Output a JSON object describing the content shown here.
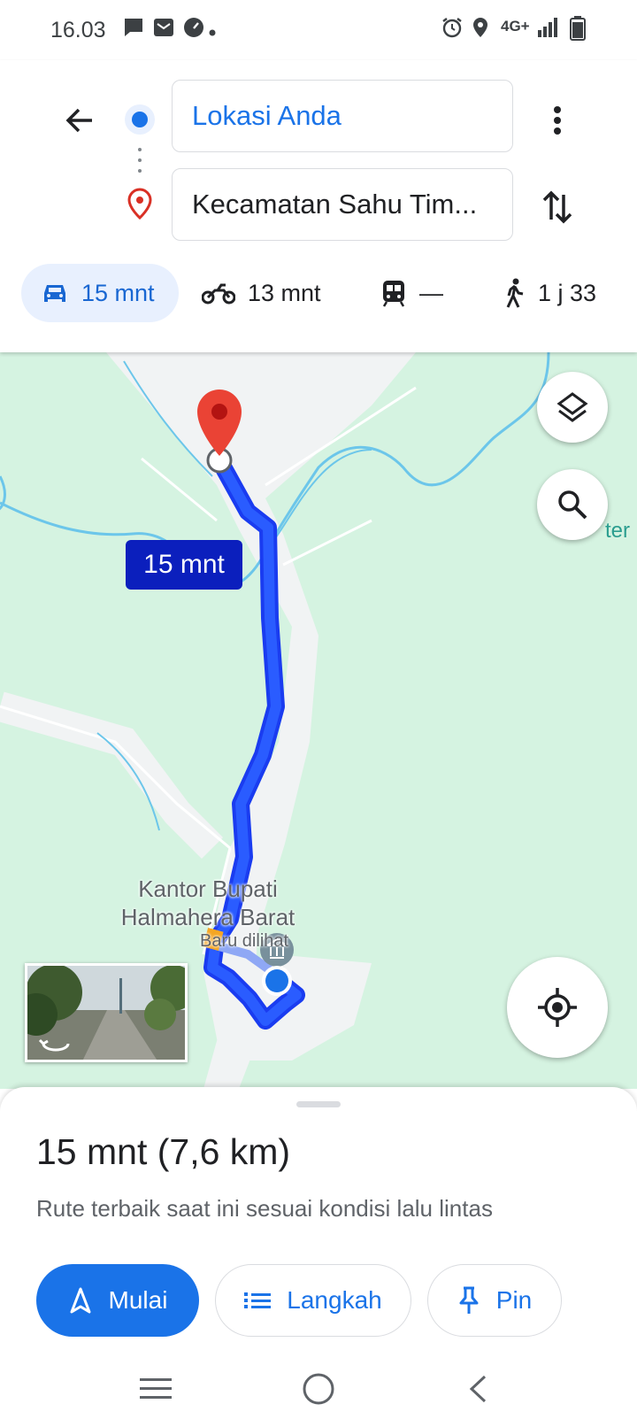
{
  "status_bar": {
    "time": "16.03",
    "network": "4G+",
    "icons": [
      "message-icon",
      "mail-icon",
      "speedometer-icon",
      "dot-icon",
      "alarm-icon",
      "location-icon",
      "signal-icon",
      "battery-icon"
    ]
  },
  "search": {
    "origin": "Lokasi Anda",
    "destination": "Kecamatan Sahu Tim..."
  },
  "modes": [
    {
      "name": "car",
      "label": "15 mnt",
      "selected": true
    },
    {
      "name": "motorcycle",
      "label": "13 mnt",
      "selected": false
    },
    {
      "name": "transit",
      "label": "—",
      "selected": false
    },
    {
      "name": "walk",
      "label": "1 j 33",
      "selected": false
    }
  ],
  "map": {
    "eta_bubble": "15 mnt",
    "edge_label": "ter",
    "poi": {
      "name_line1": "Kantor Bupati",
      "name_line2": "Halmahera Barat",
      "subtitle": "Baru dilihat"
    }
  },
  "sheet": {
    "title": "15 mnt (7,6 km)",
    "subtitle": "Rute terbaik saat ini sesuai kondisi lalu lintas",
    "start_label": "Mulai",
    "steps_label": "Langkah",
    "pin_label": "Pin"
  },
  "colors": {
    "accent": "#1a73e8",
    "route": "#1a3cf0",
    "map_bg": "#d5f3e1",
    "water": "#6cc6ea",
    "destination": "#ea4335"
  }
}
